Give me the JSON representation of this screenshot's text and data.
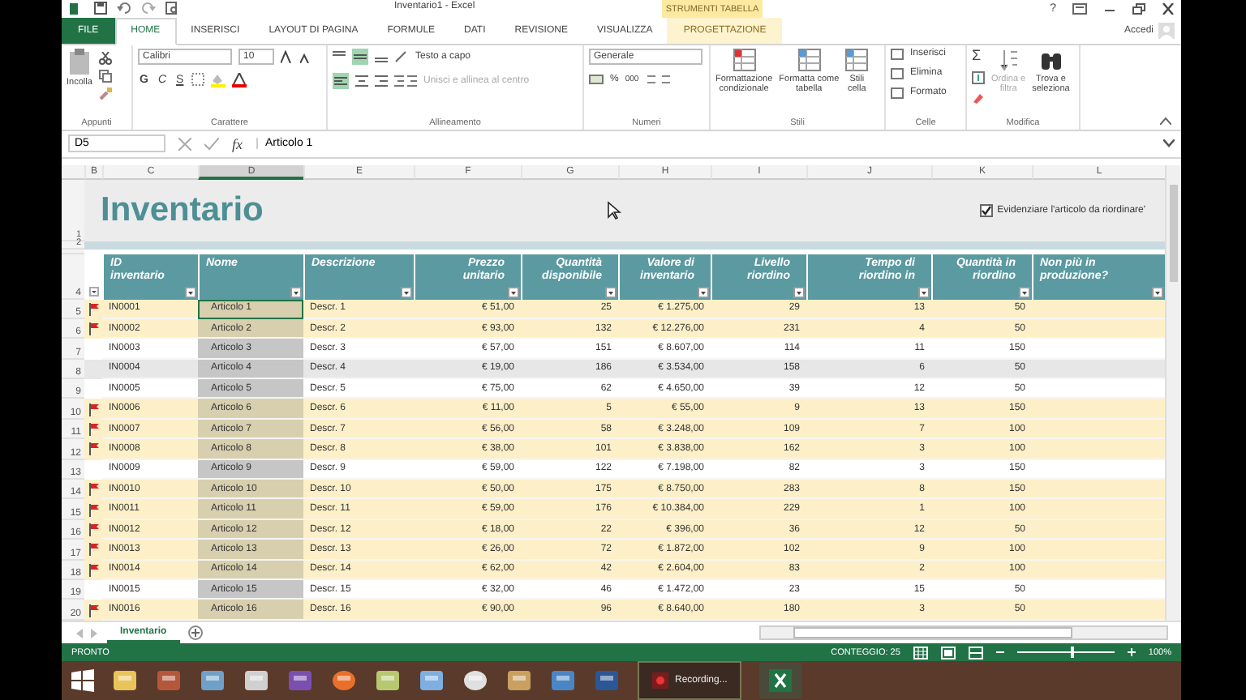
{
  "window": {
    "title": "Inventario1 - Excel",
    "context_label": "STRUMENTI TABELLA",
    "help": "?",
    "account": "Accedi"
  },
  "tabs": [
    {
      "label": "FILE",
      "kind": "file",
      "selected": false
    },
    {
      "label": "HOME",
      "kind": "tab",
      "selected": true
    },
    {
      "label": "INSERISCI",
      "kind": "tab",
      "selected": false
    },
    {
      "label": "LAYOUT DI PAGINA",
      "kind": "tab",
      "selected": false
    },
    {
      "label": "FORMULE",
      "kind": "tab",
      "selected": false
    },
    {
      "label": "DATI",
      "kind": "tab",
      "selected": false
    },
    {
      "label": "REVISIONE",
      "kind": "tab",
      "selected": false
    },
    {
      "label": "VISUALIZZA",
      "kind": "tab",
      "selected": false
    },
    {
      "label": "PROGETTAZIONE",
      "kind": "context",
      "selected": false
    }
  ],
  "ribbon": {
    "clipboard": {
      "paste": "Incolla",
      "group": "Appunti"
    },
    "font": {
      "family": "Calibri",
      "size": "10",
      "bold": "G",
      "italic": "C",
      "underline": "S",
      "group": "Carattere"
    },
    "alignment": {
      "wrap": "Testo a capo",
      "merge": "Unisci e allinea al centro",
      "group": "Allineamento"
    },
    "number": {
      "format": "Generale",
      "percent": "%",
      "thousands": "000",
      "group": "Numeri"
    },
    "styles": {
      "items": [
        "Formattazione\ncondizionale",
        "Formatta come\ntabella",
        "Stili\ncella"
      ],
      "group": "Stili"
    },
    "cells": {
      "items": [
        "Inserisci",
        "Elimina",
        "Formato"
      ],
      "group": "Celle"
    },
    "editing": {
      "sum": "Σ",
      "items": [
        "Ordina e\nfiltra",
        "Trova e\nseleziona"
      ],
      "group": "Modifica"
    }
  },
  "formula_bar": {
    "name_box": "D5",
    "fx": "fx",
    "content": "Articolo 1"
  },
  "column_letters": [
    {
      "label": "B",
      "selected": false
    },
    {
      "label": "C",
      "selected": false
    },
    {
      "label": "D",
      "selected": true
    },
    {
      "label": "E",
      "selected": false
    },
    {
      "label": "F",
      "selected": false
    },
    {
      "label": "G",
      "selected": false
    },
    {
      "label": "H",
      "selected": false
    },
    {
      "label": "I",
      "selected": false
    },
    {
      "label": "J",
      "selected": false
    },
    {
      "label": "K",
      "selected": false
    },
    {
      "label": "L",
      "selected": false
    }
  ],
  "sheet": {
    "title": "Inventario",
    "title_rows": [
      "1",
      "2"
    ],
    "highlight_option": {
      "label": "Evidenziare l'articolo da riordinare'",
      "checked": true
    },
    "header_row": "4",
    "columns": [
      "ID\ninventario",
      "Nome",
      "Descrizione",
      "Prezzo\nunitario",
      "Quantità\ndisponibile",
      "Valore di\ninventario",
      "Livello\nriordino",
      "Tempo di\nriordino in",
      "Quantità in\nriordino",
      "Non più in\nproduzione?"
    ],
    "rows": [
      {
        "num": "5",
        "cells": [
          "IN0001",
          "Articolo 1",
          "Descr. 1",
          "€ 51,00",
          "25",
          "€ 1.275,00",
          "29",
          "13",
          "50"
        ],
        "highlight": true,
        "active": true
      },
      {
        "num": "6",
        "cells": [
          "IN0002",
          "Articolo 2",
          "Descr. 2",
          "€ 93,00",
          "132",
          "€ 12.276,00",
          "231",
          "4",
          "50"
        ],
        "highlight": true,
        "active": false
      },
      {
        "num": "7",
        "cells": [
          "IN0003",
          "Articolo 3",
          "Descr. 3",
          "€ 57,00",
          "151",
          "€ 8.607,00",
          "114",
          "11",
          "150"
        ],
        "highlight": false,
        "active": false
      },
      {
        "num": "8",
        "cells": [
          "IN0004",
          "Articolo 4",
          "Descr. 4",
          "€ 19,00",
          "186",
          "€ 3.534,00",
          "158",
          "6",
          "50"
        ],
        "highlight": false,
        "active": false
      },
      {
        "num": "9",
        "cells": [
          "IN0005",
          "Articolo 5",
          "Descr. 5",
          "€ 75,00",
          "62",
          "€ 4.650,00",
          "39",
          "12",
          "50"
        ],
        "highlight": false,
        "active": false
      },
      {
        "num": "10",
        "cells": [
          "IN0006",
          "Articolo 6",
          "Descr. 6",
          "€ 11,00",
          "5",
          "€ 55,00",
          "9",
          "13",
          "150"
        ],
        "highlight": true,
        "active": false
      },
      {
        "num": "11",
        "cells": [
          "IN0007",
          "Articolo 7",
          "Descr. 7",
          "€ 56,00",
          "58",
          "€ 3.248,00",
          "109",
          "7",
          "100"
        ],
        "highlight": true,
        "active": false
      },
      {
        "num": "12",
        "cells": [
          "IN0008",
          "Articolo 8",
          "Descr. 8",
          "€ 38,00",
          "101",
          "€ 3.838,00",
          "162",
          "3",
          "100"
        ],
        "highlight": true,
        "active": false
      },
      {
        "num": "13",
        "cells": [
          "IN0009",
          "Articolo 9",
          "Descr. 9",
          "€ 59,00",
          "122",
          "€ 7.198,00",
          "82",
          "3",
          "150"
        ],
        "highlight": false,
        "active": false
      },
      {
        "num": "14",
        "cells": [
          "IN0010",
          "Articolo 10",
          "Descr. 10",
          "€ 50,00",
          "175",
          "€ 8.750,00",
          "283",
          "8",
          "150"
        ],
        "highlight": true,
        "active": false
      },
      {
        "num": "15",
        "cells": [
          "IN0011",
          "Articolo 11",
          "Descr. 11",
          "€ 59,00",
          "176",
          "€ 10.384,00",
          "229",
          "1",
          "100"
        ],
        "highlight": true,
        "active": false
      },
      {
        "num": "16",
        "cells": [
          "IN0012",
          "Articolo 12",
          "Descr. 12",
          "€ 18,00",
          "22",
          "€ 396,00",
          "36",
          "12",
          "50"
        ],
        "highlight": true,
        "active": false
      },
      {
        "num": "17",
        "cells": [
          "IN0013",
          "Articolo 13",
          "Descr. 13",
          "€ 26,00",
          "72",
          "€ 1.872,00",
          "102",
          "9",
          "100"
        ],
        "highlight": true,
        "active": false
      },
      {
        "num": "18",
        "cells": [
          "IN0014",
          "Articolo 14",
          "Descr. 14",
          "€ 62,00",
          "42",
          "€ 2.604,00",
          "83",
          "2",
          "100"
        ],
        "highlight": true,
        "active": false
      },
      {
        "num": "19",
        "cells": [
          "IN0015",
          "Articolo 15",
          "Descr. 15",
          "€ 32,00",
          "46",
          "€ 1.472,00",
          "23",
          "15",
          "50"
        ],
        "highlight": false,
        "active": false
      },
      {
        "num": "20",
        "cells": [
          "IN0016",
          "Articolo 16",
          "Descr. 16",
          "€ 90,00",
          "96",
          "€ 8.640,00",
          "180",
          "3",
          "50"
        ],
        "highlight": true,
        "active": false
      }
    ]
  },
  "sheet_tabs": [
    {
      "label": "Inventario",
      "selected": true
    }
  ],
  "status_bar": {
    "mode": "PRONTO",
    "count": "CONTEGGIO: 25",
    "zoom": "100%",
    "zoom_level": {
      "level": 0.55
    }
  },
  "taskbar": {
    "recording": "Recording..."
  }
}
